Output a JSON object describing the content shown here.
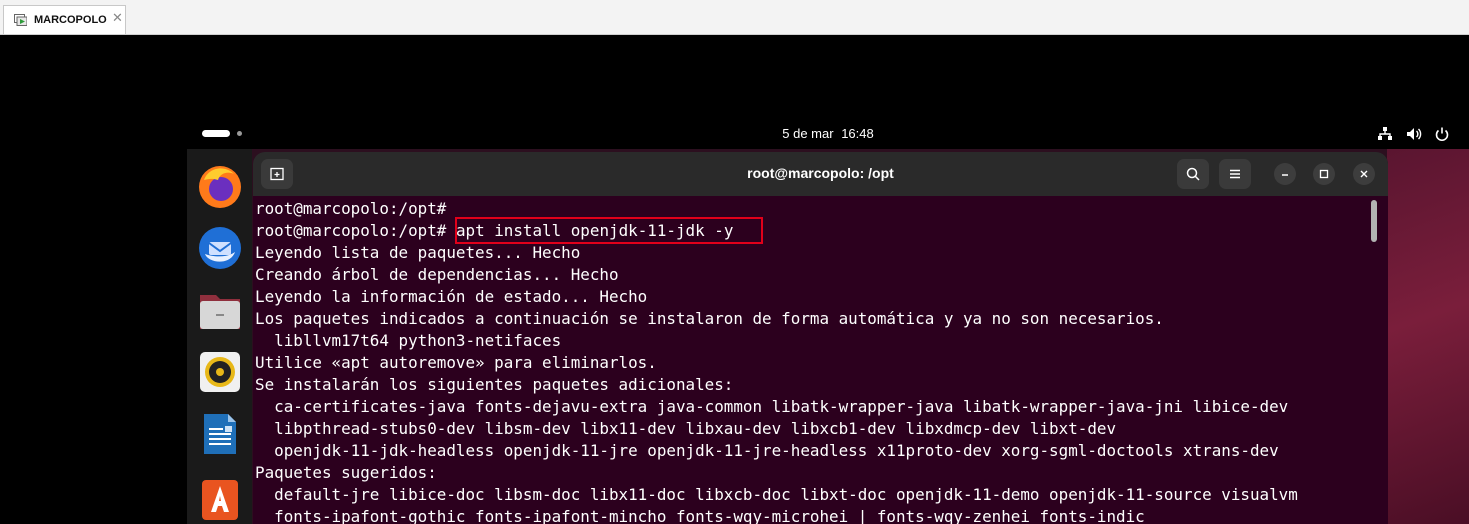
{
  "host": {
    "tab_title": "MARCOPOLO",
    "tab_icon": "vm-icon",
    "close_glyph": "✕"
  },
  "topbar": {
    "date": "5 de mar",
    "time": "16:48",
    "tray_icons": [
      "network-icon",
      "volume-icon",
      "power-icon"
    ]
  },
  "dock": {
    "items": [
      "firefox-icon",
      "thunderbird-icon",
      "files-icon",
      "rhythmbox-icon",
      "writer-icon",
      "app-center-icon"
    ]
  },
  "terminal": {
    "title": "root@marcopolo: /opt",
    "prompt": "root@marcopolo:/opt#",
    "highlighted_command": "apt install openjdk-11-jdk -y",
    "highlight_color": "#e1001a",
    "background": "#2c001e",
    "lines": [
      "root@marcopolo:/opt#",
      "",
      "Leyendo lista de paquetes... Hecho",
      "Creando árbol de dependencias... Hecho",
      "Leyendo la información de estado... Hecho",
      "Los paquetes indicados a continuación se instalaron de forma automática y ya no son necesarios.",
      "  libllvm17t64 python3-netifaces",
      "Utilice «apt autoremove» para eliminarlos.",
      "Se instalarán los siguientes paquetes adicionales:",
      "  ca-certificates-java fonts-dejavu-extra java-common libatk-wrapper-java libatk-wrapper-java-jni libice-dev",
      "  libpthread-stubs0-dev libsm-dev libx11-dev libxau-dev libxcb1-dev libxdmcp-dev libxt-dev",
      "  openjdk-11-jdk-headless openjdk-11-jre openjdk-11-jre-headless x11proto-dev xorg-sgml-doctools xtrans-dev",
      "Paquetes sugeridos:",
      "  default-jre libice-doc libsm-doc libx11-doc libxcb-doc libxt-doc openjdk-11-demo openjdk-11-source visualvm",
      "  fonts-ipafont-gothic fonts-ipafont-mincho fonts-wqy-microhei | fonts-wqy-zenhei fonts-indic"
    ]
  }
}
